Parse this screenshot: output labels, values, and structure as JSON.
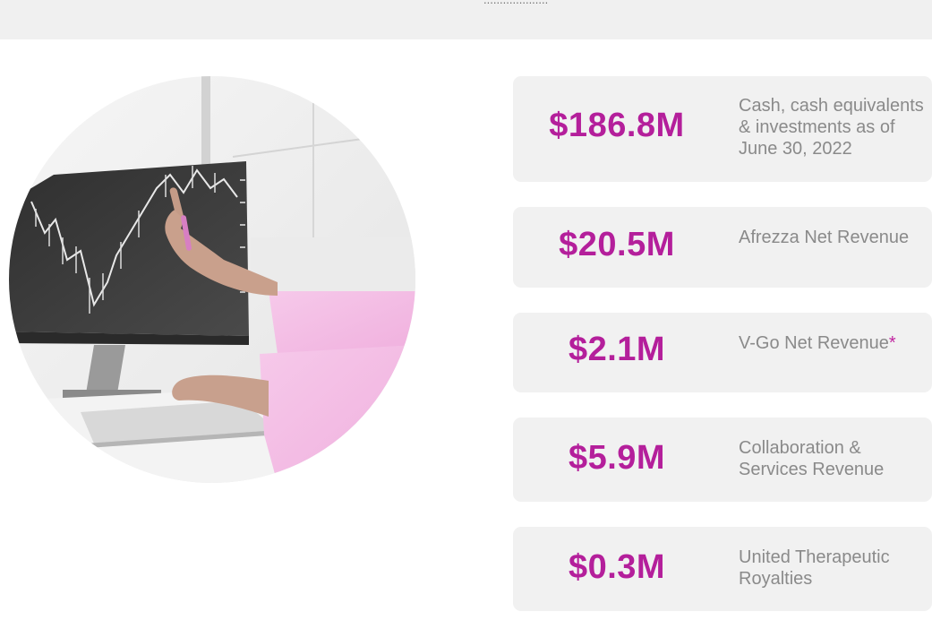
{
  "header": {
    "partial_text": "...................."
  },
  "stats": [
    {
      "value": "$186.8M",
      "label_lines": [
        "Cash, cash equivalents",
        "& investments as of",
        "June 30, 2022"
      ]
    },
    {
      "value": "$20.5M",
      "label_lines": [
        "Afrezza Net Revenue"
      ]
    },
    {
      "value": "$2.1M",
      "label_lines": [
        "V-Go Net Revenue"
      ],
      "footnote_mark": "*"
    },
    {
      "value": "$5.9M",
      "label_lines": [
        "Collaboration &",
        "Services Revenue"
      ]
    },
    {
      "value": "$0.3M",
      "label_lines": [
        "United Therapeutic",
        "Royalties"
      ]
    }
  ],
  "colors": {
    "accent": "#b41f9b",
    "card_bg": "#f1f1f1",
    "label_text": "#8a8a8a",
    "top_band": "#f0f0f0"
  }
}
